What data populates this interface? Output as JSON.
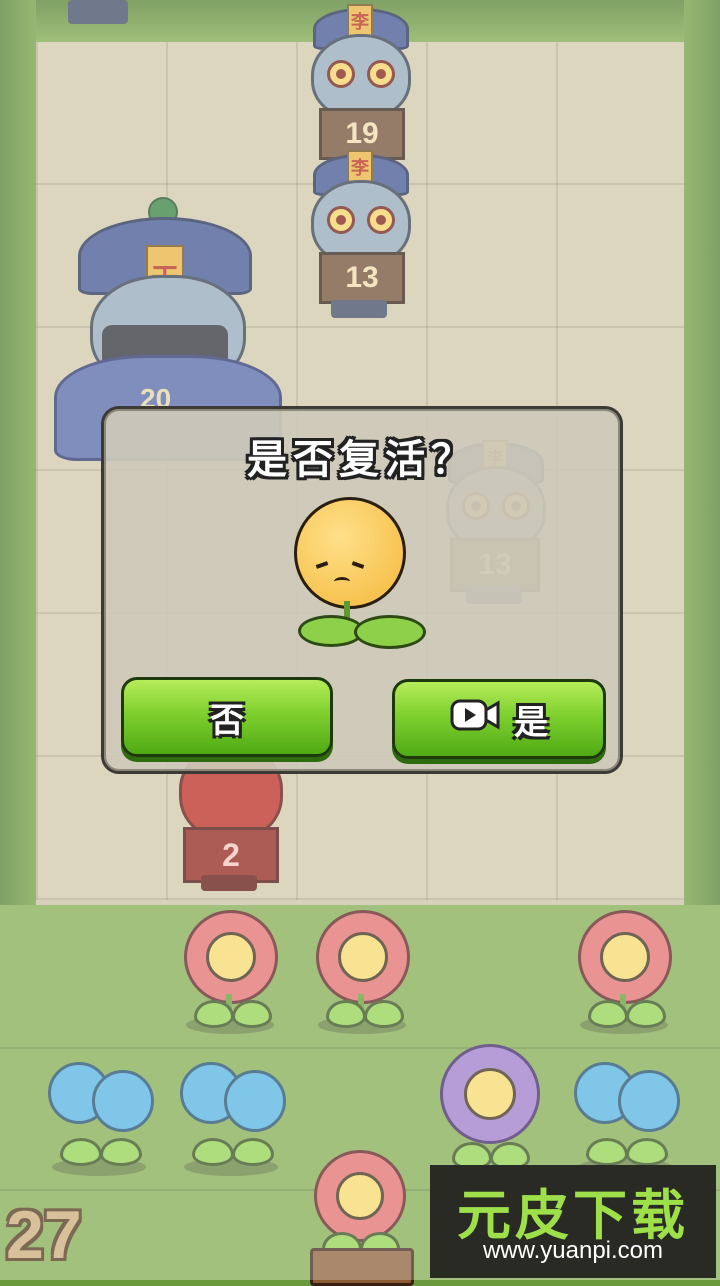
{
  "zombies": [
    {
      "label": "19",
      "hat_glyph": "李"
    },
    {
      "label": "13",
      "hat_glyph": "李"
    },
    {
      "label": "13",
      "hat_glyph": "李"
    },
    {
      "label": "2"
    }
  ],
  "boss": {
    "label": "20",
    "hat_glyph": "天"
  },
  "dialog": {
    "title": "是否复活？",
    "no_label": "否",
    "yes_label": "是"
  },
  "icons": {
    "video": "video-camera-icon",
    "sad_plant": "sad-sprout-icon"
  },
  "score": "27",
  "watermark": {
    "title": "元皮下载",
    "url": "www.yuanpi.com"
  },
  "colors": {
    "button_green": "#7fd02e",
    "grass": "#7fa94a",
    "board": "#cfc7a7"
  }
}
